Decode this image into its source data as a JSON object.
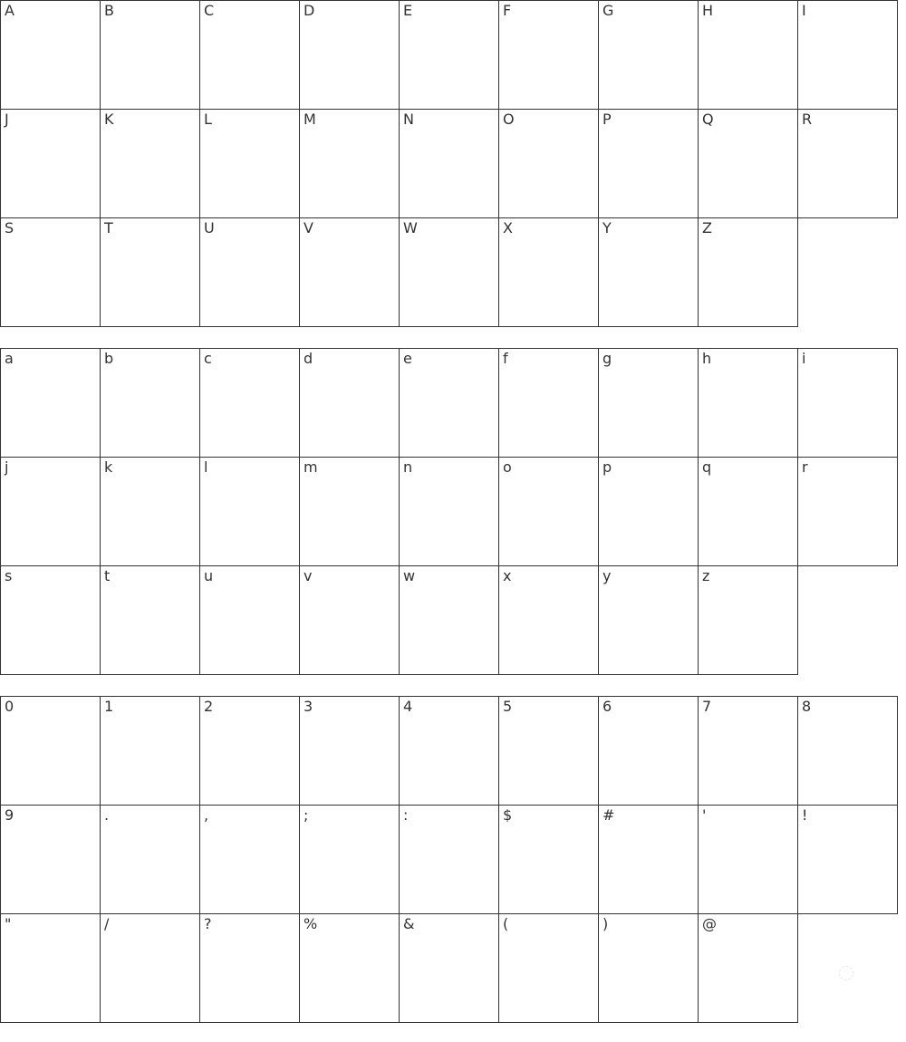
{
  "sections": [
    {
      "name": "uppercase",
      "glyphs": [
        "A",
        "B",
        "C",
        "D",
        "E",
        "F",
        "G",
        "H",
        "I",
        "J",
        "K",
        "L",
        "M",
        "N",
        "O",
        "P",
        "Q",
        "R",
        "S",
        "T",
        "U",
        "V",
        "W",
        "X",
        "Y",
        "Z"
      ]
    },
    {
      "name": "lowercase",
      "glyphs": [
        "a",
        "b",
        "c",
        "d",
        "e",
        "f",
        "g",
        "h",
        "i",
        "j",
        "k",
        "l",
        "m",
        "n",
        "o",
        "p",
        "q",
        "r",
        "s",
        "t",
        "u",
        "v",
        "w",
        "x",
        "y",
        "z"
      ]
    },
    {
      "name": "numerals-and-punctuation",
      "glyphs": [
        "0",
        "1",
        "2",
        "3",
        "4",
        "5",
        "6",
        "7",
        "8",
        "9",
        ".",
        ",",
        ";",
        ":",
        "$",
        "#",
        "'",
        "!",
        "\"",
        "/",
        "?",
        "%",
        "&",
        "(",
        ")",
        "@"
      ]
    }
  ],
  "colors": {
    "border": "#333333",
    "text": "#333333",
    "background": "#ffffff"
  },
  "icons": {
    "loading": "loading-spinner-icon"
  }
}
